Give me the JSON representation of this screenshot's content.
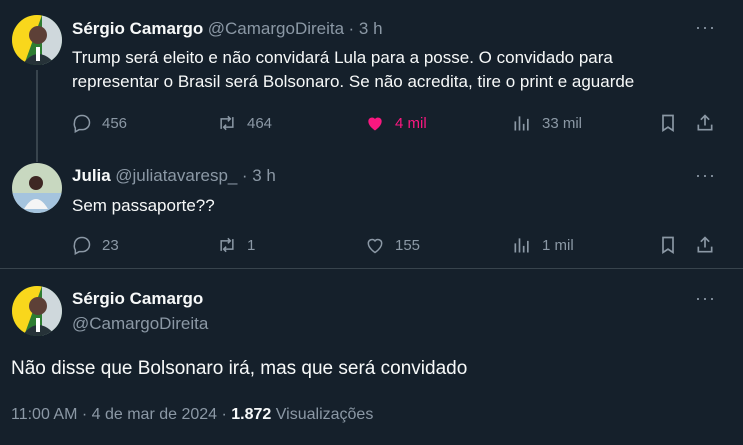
{
  "tweet1": {
    "name": "Sérgio Camargo",
    "handle": "@CamargoDireita",
    "time": "· 3 h",
    "text_line1": "Trump será eleito e não convidará Lula para a posse. O convidado para",
    "text_line2": "representar o Brasil será Bolsonaro. Se não acredita, tire o print e aguarde",
    "replies": "456",
    "retweets": "464",
    "likes": "4 mil",
    "views": "33 mil"
  },
  "tweet2": {
    "name": "Julia",
    "handle": "@juliatavaresp_",
    "time": "· 3 h",
    "text": "Sem passaporte??",
    "replies": "23",
    "retweets": "1",
    "likes": "155",
    "views": "1 mil"
  },
  "main": {
    "name": "Sérgio Camargo",
    "handle": "@CamargoDireita",
    "text": "Não disse que Bolsonaro irá, mas que será convidado",
    "timestamp": "11:00 AM · 4 de mar de 2024 ·",
    "views_count": "1.872",
    "views_label": "Visualizações"
  },
  "more_glyph": "···",
  "colors": {
    "background": "#15202b",
    "muted": "#8b98a5",
    "like_active": "#f91880",
    "divider": "#38444d"
  }
}
